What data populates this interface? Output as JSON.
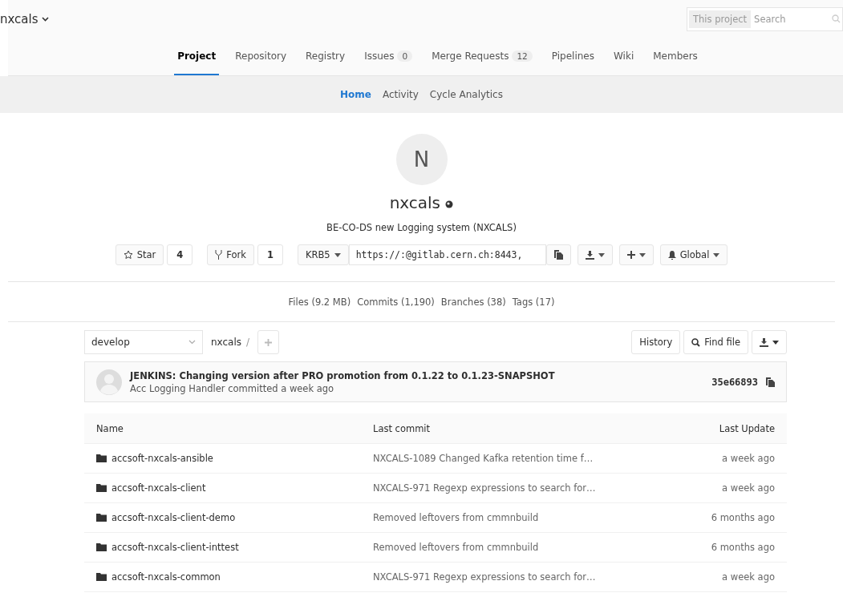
{
  "header": {
    "project": "nxcals",
    "search": {
      "scope": "This project",
      "placeholder": "Search"
    }
  },
  "nav_tabs": [
    {
      "label": "Project",
      "selected": true
    },
    {
      "label": "Repository",
      "selected": false
    },
    {
      "label": "Registry",
      "selected": false
    },
    {
      "label": "Issues",
      "count": "0",
      "selected": false
    },
    {
      "label": "Merge Requests",
      "count": "12",
      "selected": false
    },
    {
      "label": "Pipelines",
      "selected": false
    },
    {
      "label": "Wiki",
      "selected": false
    },
    {
      "label": "Members",
      "selected": false
    }
  ],
  "sub_tabs": [
    {
      "label": "Home",
      "selected": true
    },
    {
      "label": "Activity",
      "selected": false
    },
    {
      "label": "Cycle Analytics",
      "selected": false
    }
  ],
  "project": {
    "avatar": "N",
    "name": "nxcals",
    "description": "BE-CO-DS new Logging system (NXCALS)"
  },
  "actions": {
    "star": {
      "label": "Star",
      "count": "4"
    },
    "fork": {
      "label": "Fork",
      "count": "1"
    },
    "protocol": "KRB5",
    "url": "https://:@gitlab.cern.ch:8443,",
    "notification": "Global"
  },
  "stats": [
    "Files (9.2 MB)",
    "Commits (1,190)",
    "Branches (38)",
    "Tags (17)"
  ],
  "tree": {
    "branch": "develop",
    "path": "nxcals",
    "slash": "/",
    "history": "History",
    "find_file": "Find file"
  },
  "commit": {
    "title": "JENKINS: Changing version after PRO promotion from 0.1.22 to 0.1.23-SNAPSHOT",
    "meta": "Acc Logging Handler committed a week ago",
    "sha": "35e66893"
  },
  "table": {
    "columns": [
      "Name",
      "Last commit",
      "Last Update"
    ],
    "rows": [
      {
        "name": "accsoft-nxcals-ansible",
        "commit": "NXCALS-1089 Changed Kafka retention time f…",
        "updated": "a week ago"
      },
      {
        "name": "accsoft-nxcals-client",
        "commit": "NXCALS-971 Regexp expressions to search for…",
        "updated": "a week ago"
      },
      {
        "name": "accsoft-nxcals-client-demo",
        "commit": "Removed leftovers from cmmnbuild",
        "updated": "6 months ago"
      },
      {
        "name": "accsoft-nxcals-client-inttest",
        "commit": "Removed leftovers from cmmnbuild",
        "updated": "6 months ago"
      },
      {
        "name": "accsoft-nxcals-common",
        "commit": "NXCALS-971 Regexp expressions to search for…",
        "updated": "a week ago"
      }
    ]
  }
}
